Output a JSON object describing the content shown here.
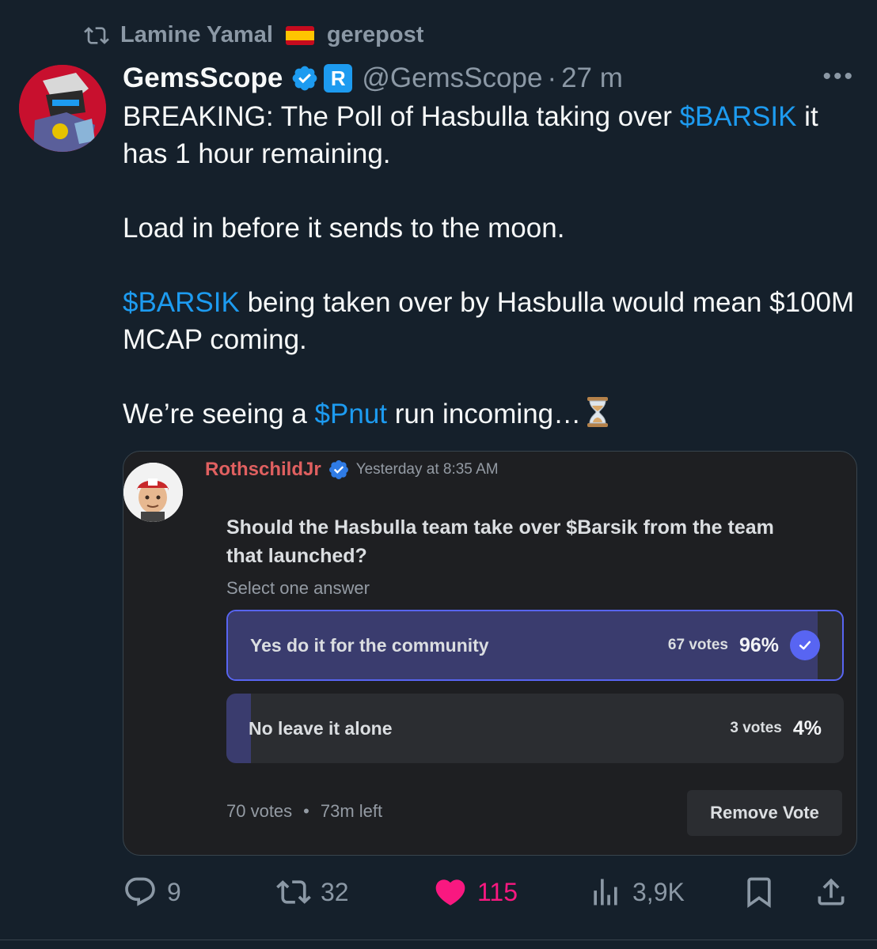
{
  "repost": {
    "user": "Lamine Yamal",
    "action_label": "gerepost"
  },
  "tweet": {
    "display_name": "GemsScope",
    "affiliate_badge": "R",
    "handle": "@GemsScope",
    "separator": "·",
    "time": "27 m",
    "more": "•••",
    "text": {
      "line1_prefix": "BREAKING: The Poll of Hasbulla taking over ",
      "cashtag1": "$BARSIK",
      "line1_suffix": " it has 1 hour remaining.",
      "line2": "Load in before it sends to the moon.",
      "cashtag2": "$BARSIK",
      "line3_suffix": " being taken over by Hasbulla would mean $100M MCAP coming.",
      "line4_prefix": "We’re seeing a ",
      "cashtag3": "$Pnut",
      "line4_suffix": " run incoming…"
    }
  },
  "poll_image": {
    "author": "RothschildJr",
    "timestamp": "Yesterday at 8:35 AM",
    "question": "Should the Hasbulla team take over $Barsik from the team that launched?",
    "hint": "Select one answer",
    "options": [
      {
        "label": "Yes do it for the community",
        "votes": "67 votes",
        "percent": "96%",
        "fill_fraction": 0.96,
        "selected": true
      },
      {
        "label": "No leave it alone",
        "votes": "3 votes",
        "percent": "4%",
        "fill_fraction": 0.04,
        "selected": false
      }
    ],
    "total_votes": "70 votes",
    "footer_dot": "•",
    "time_left": "73m left",
    "remove_vote_label": "Remove Vote"
  },
  "actions": {
    "replies": "9",
    "reposts": "32",
    "likes": "115",
    "views": "3,9K"
  },
  "colors": {
    "background": "#15202b",
    "link": "#1d9bf0",
    "like": "#f91880",
    "muted": "#8b98a5",
    "discord_accent": "#5865f2"
  }
}
